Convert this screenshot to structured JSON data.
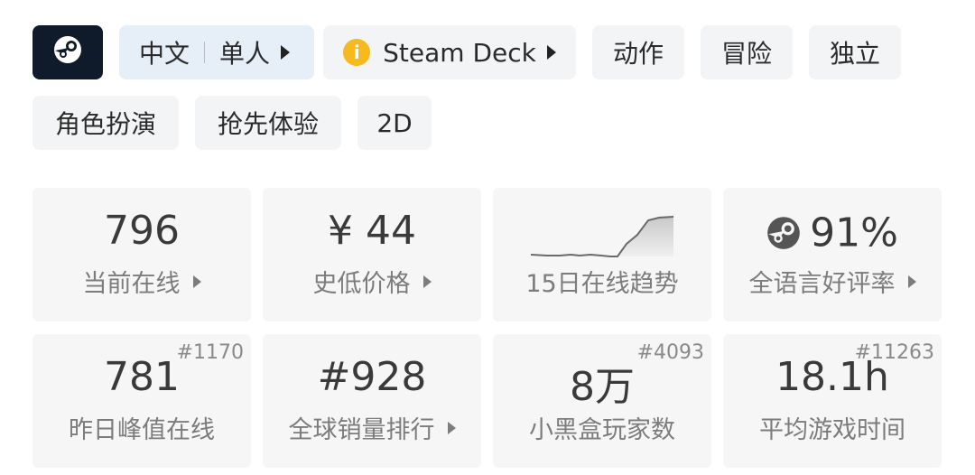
{
  "tags_row1": {
    "lang_a": "中文",
    "lang_b": "单人",
    "deck_label": "Steam Deck",
    "deck_info_glyph": "i",
    "tag_action": "动作",
    "tag_adventure": "冒险",
    "tag_indie": "独立"
  },
  "tags_row2": {
    "tag_rpg": "角色扮演",
    "tag_early_access": "抢先体验",
    "tag_2d": "2D"
  },
  "stats": {
    "current_online": {
      "value": "796",
      "label": "当前在线"
    },
    "lowest_price": {
      "value": "¥ 44",
      "label": "史低价格"
    },
    "trend": {
      "label": "15日在线趋势"
    },
    "review": {
      "value": "91%",
      "label": "全语言好评率"
    },
    "peak_yesterday": {
      "value": "781",
      "rank": "#1170",
      "label": "昨日峰值在线"
    },
    "global_sales": {
      "value": "#928",
      "label": "全球销量排行"
    },
    "xhh_players": {
      "value": "8万",
      "rank": "#4093",
      "label": "小黑盒玩家数"
    },
    "avg_playtime": {
      "value": "18.1h",
      "rank": "#11263",
      "label": "平均游戏时间"
    }
  },
  "icons": {
    "steam": "steam-icon",
    "info": "info-icon",
    "arrow": "triangle-right-icon"
  },
  "colors": {
    "steam_bg": "#0f1b2a",
    "lang_chip_bg": "#e6eef8",
    "chip_bg": "#f3f4f6",
    "card_bg": "#f6f6f6",
    "info_yellow": "#f7b91b"
  }
}
